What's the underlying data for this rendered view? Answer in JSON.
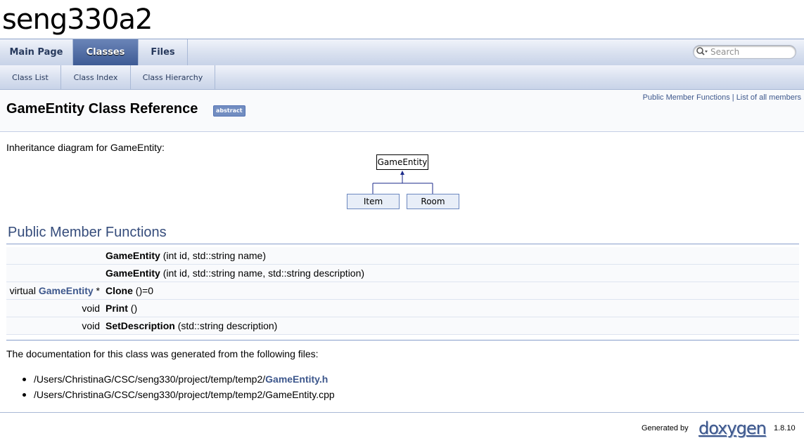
{
  "project": {
    "title": "seng330a2"
  },
  "main_tabs": [
    {
      "label": "Main Page",
      "active": false
    },
    {
      "label": "Classes",
      "active": true
    },
    {
      "label": "Files",
      "active": false
    }
  ],
  "search": {
    "placeholder": "Search"
  },
  "sub_tabs": [
    {
      "label": "Class List"
    },
    {
      "label": "Class Index"
    },
    {
      "label": "Class Hierarchy"
    }
  ],
  "summary": {
    "public_member_functions": "Public Member Functions",
    "separator": "|",
    "all_members": "List of all members"
  },
  "header": {
    "title": "GameEntity Class Reference",
    "badge": "abstract"
  },
  "inheritance": {
    "label": "Inheritance diagram for GameEntity:",
    "parent": "GameEntity",
    "children": [
      "Item",
      "Room"
    ]
  },
  "section": {
    "title": "Public Member Functions"
  },
  "members": [
    {
      "prefix": "",
      "type_link": "",
      "suffix": "",
      "name": "GameEntity",
      "args": " (int id, std::string name)"
    },
    {
      "prefix": "",
      "type_link": "",
      "suffix": "",
      "name": "GameEntity",
      "args": " (int id, std::string name, std::string description)"
    },
    {
      "prefix": "virtual ",
      "type_link": "GameEntity",
      "suffix": " *",
      "name": "Clone",
      "args": " ()=0"
    },
    {
      "prefix": "void",
      "type_link": "",
      "suffix": "",
      "name": "Print",
      "args": " ()"
    },
    {
      "prefix": "void",
      "type_link": "",
      "suffix": "",
      "name": "SetDescription",
      "args": " (std::string description)"
    }
  ],
  "files_intro": "The documentation for this class was generated from the following files:",
  "files": [
    {
      "path": "/Users/ChristinaG/CSC/seng330/project/temp/temp2/",
      "link": "GameEntity.h"
    },
    {
      "path": "/Users/ChristinaG/CSC/seng330/project/temp/temp2/GameEntity.cpp",
      "link": ""
    }
  ],
  "footer": {
    "generated_by": "Generated by",
    "logo": "doxygen",
    "version": "1.8.10"
  },
  "colors": {
    "link": "#3d578c",
    "tab_active": "#3e5b95"
  }
}
